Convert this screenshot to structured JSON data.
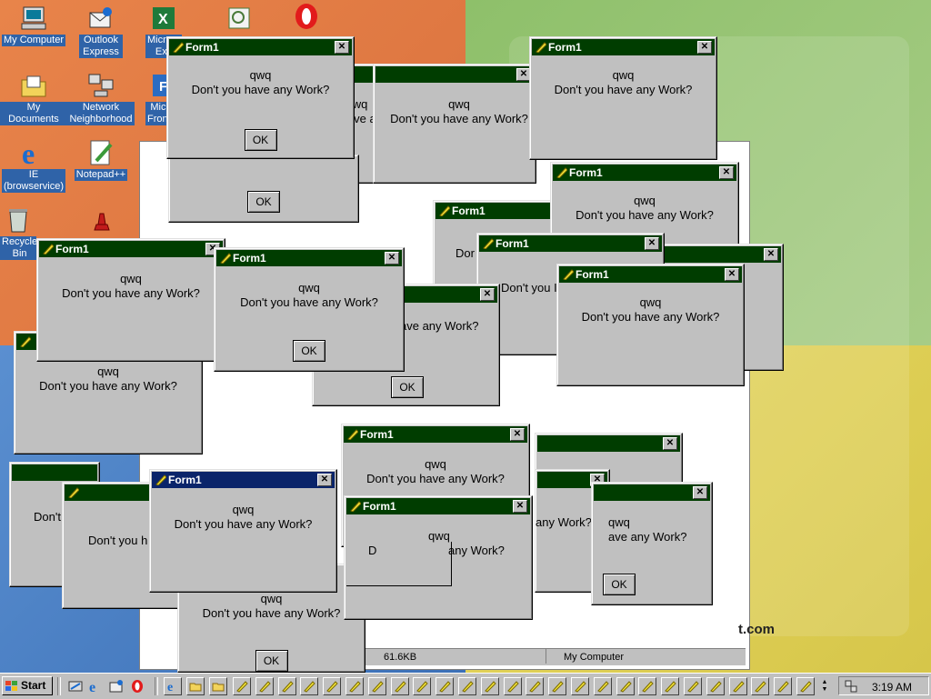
{
  "desktop": {
    "icons": [
      {
        "label": "My Computer",
        "icon": "my-computer-icon"
      },
      {
        "label": "Outlook Express",
        "icon": "outlook-express-icon"
      },
      {
        "label": "Microsoft Excel",
        "icon": "excel-icon"
      },
      {
        "label": "",
        "icon": "generic-program-icon"
      },
      {
        "label": "",
        "icon": "opera-icon"
      },
      {
        "label": "My Documents",
        "icon": "my-documents-icon"
      },
      {
        "label": "Network Neighborhood",
        "icon": "network-neighborhood-icon"
      },
      {
        "label": "Microsoft FrontPage",
        "icon": "frontpage-icon"
      },
      {
        "label": "IE (browservice)",
        "icon": "internet-explorer-icon"
      },
      {
        "label": "Notepad++",
        "icon": "notepad-plus-plus-icon"
      },
      {
        "label": "Recycle Bin",
        "icon": "recycle-bin-icon"
      },
      {
        "label": "",
        "icon": "chess-app-icon"
      }
    ],
    "colors": {
      "orange": "#e07b44",
      "green": "#97c47a",
      "blue": "#4a80c6",
      "yellow": "#dfd158"
    }
  },
  "dialog": {
    "title": "Form1",
    "line1": "qwq",
    "line2": "Don't you have any Work?",
    "ok_label": "OK",
    "close_glyph": "✕",
    "titlebar_color": "#003d00",
    "active_titlebar_color": "#0a246a"
  },
  "fragments": {
    "dont_partial": "Don't you h",
    "dont_short": "Don't",
    "dor": "Dor",
    "dont_you_i": "Don't you I",
    "ave_work": "ave any Work?",
    "work_q": "Work?",
    "rk_q": "rk?",
    "ork_q": "ork?",
    "ny_work": "any Work?",
    "ad": "Ad",
    "d_letter": "D",
    "k_letter": "k",
    "ok_partial": "OK",
    "don_partial": "Don",
    "qwq": "qwq"
  },
  "explorer": {
    "status_size": "61.6KB",
    "status_location": "My Computer",
    "watermark": "t.com"
  },
  "taskbar": {
    "start_label": "Start",
    "clock": "3:19 AM",
    "form_button_count": 26
  }
}
